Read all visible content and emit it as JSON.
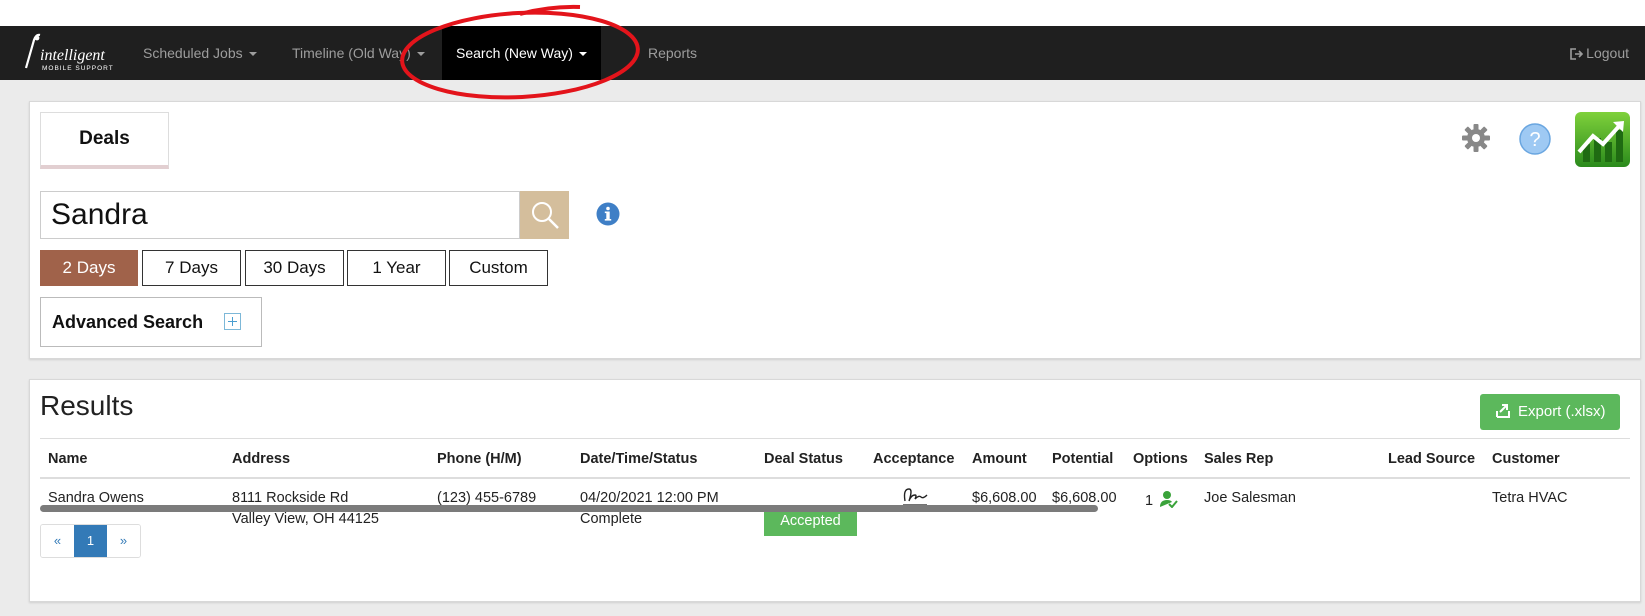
{
  "nav": {
    "brand_text": "intelligent",
    "brand_sub": "MOBILE SUPPORT",
    "items": [
      {
        "label": "Scheduled Jobs"
      },
      {
        "label": "Timeline (Old Way)"
      },
      {
        "label": "Search (New Way)"
      },
      {
        "label": "Reports"
      }
    ],
    "logout": "Logout"
  },
  "search_panel": {
    "tab_label": "Deals",
    "query": "Sandra",
    "ranges": [
      "2 Days",
      "7 Days",
      "30 Days",
      "1 Year",
      "Custom"
    ],
    "active_range": "2 Days",
    "advanced_label": "Advanced Search"
  },
  "results": {
    "title": "Results",
    "export_label": "Export (.xlsx)",
    "columns": [
      "Name",
      "Address",
      "Phone (H/M)",
      "Date/Time/Status",
      "Deal Status",
      "Acceptance",
      "Amount",
      "Potential",
      "Options",
      "Sales Rep",
      "Lead Source",
      "Customer"
    ],
    "rows": [
      {
        "name": "Sandra Owens",
        "address_line1": "8111 Rockside Rd",
        "address_line2": "Valley View, OH 44125",
        "phone": "(123) 455-6789",
        "datetime": "04/20/2021 12:00 PM",
        "status": "Complete",
        "deal_status": "Accepted",
        "acceptance": "signature-icon",
        "amount": "$6,608.00",
        "potential": "$6,608.00",
        "options": "1",
        "sales_rep": "Joe Salesman",
        "lead_source": "",
        "customer": "Tetra HVAC"
      }
    ],
    "pager": [
      "«",
      "1",
      "»"
    ]
  },
  "colors": {
    "navbar": "#1f1f1f",
    "active_range": "#a0624a",
    "search_button": "#d4be9c",
    "success": "#5cb85c",
    "link": "#337ab7",
    "annotation": "#e3141b"
  }
}
